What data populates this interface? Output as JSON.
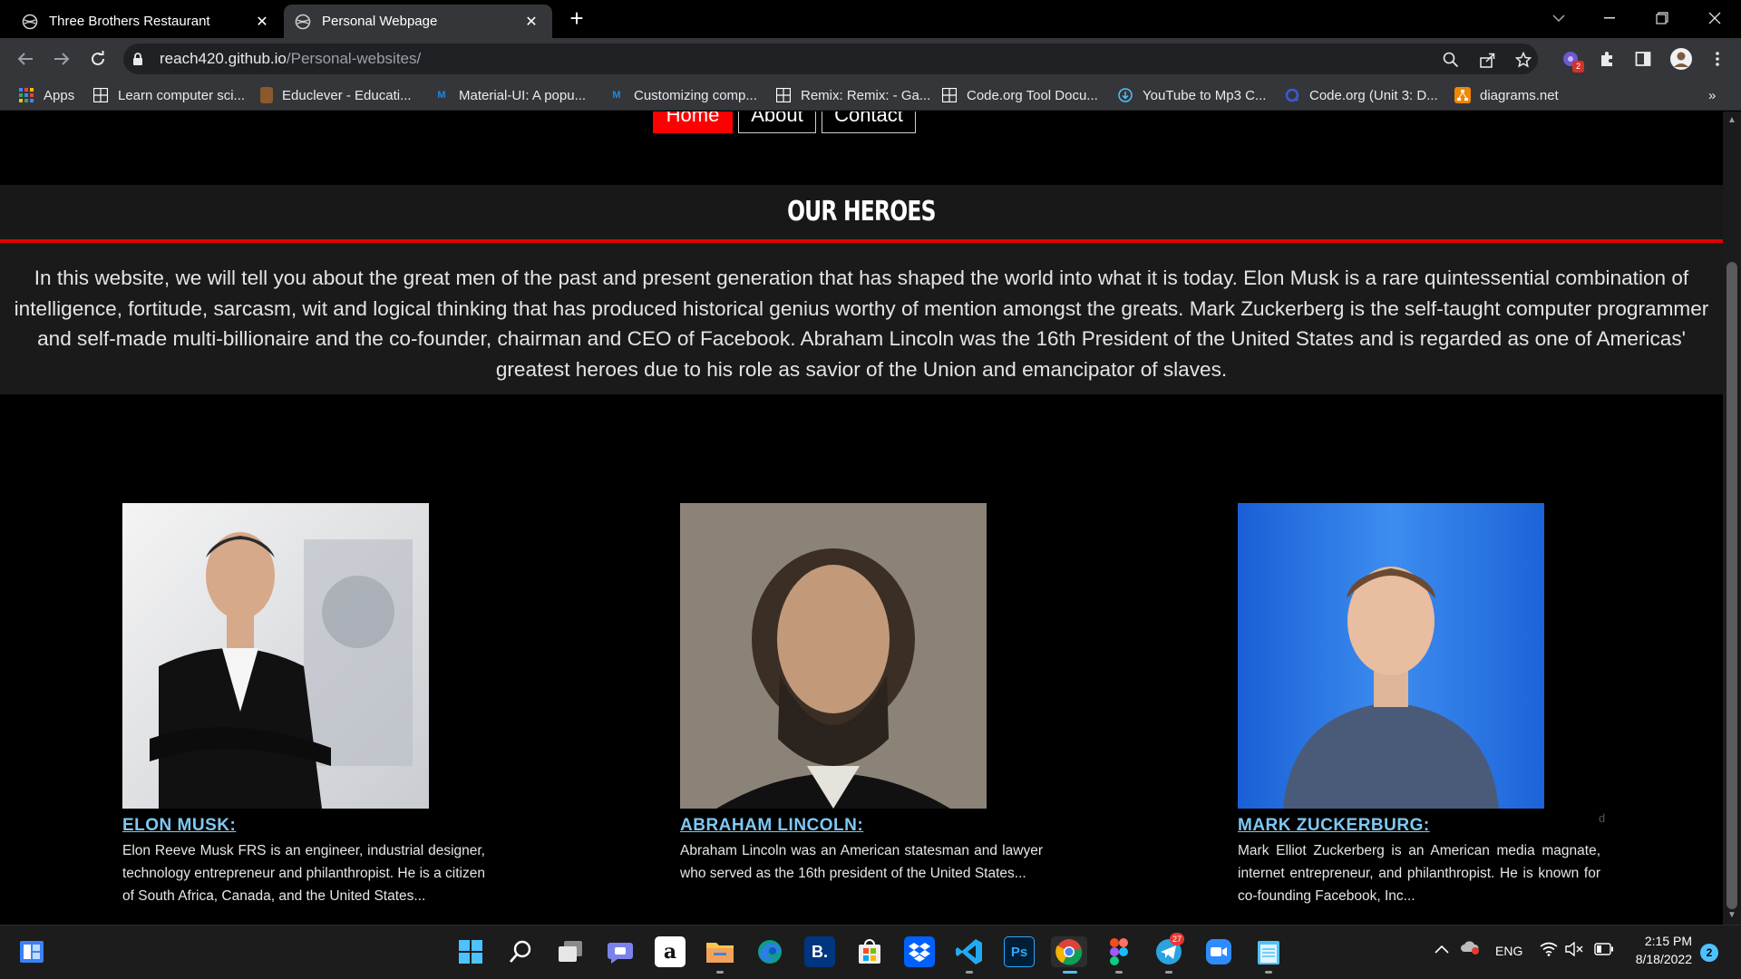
{
  "browser": {
    "tabs": [
      {
        "title": "Three Brothers Restaurant",
        "active": false
      },
      {
        "title": "Personal Webpage",
        "active": true
      }
    ],
    "url_host": "reach420.github.io",
    "url_path": "/Personal-websites/",
    "extension_badge": "2",
    "bookmarks": [
      {
        "label": "Apps",
        "icon": "apps-grid-icon",
        "color": "#4285f4"
      },
      {
        "label": "Learn computer sci...",
        "icon": "code-org-icon",
        "color": "#ffffff"
      },
      {
        "label": "Educlever - Educati...",
        "icon": "educlever-icon",
        "color": "#8a5a2b"
      },
      {
        "label": "Material-UI: A popu...",
        "icon": "mui-icon",
        "color": "#1e88e5"
      },
      {
        "label": "Customizing comp...",
        "icon": "mui-icon",
        "color": "#1e88e5"
      },
      {
        "label": "Remix: Remix: - Ga...",
        "icon": "code-org-icon",
        "color": "#ffffff"
      },
      {
        "label": "Code.org Tool Docu...",
        "icon": "code-org-icon",
        "color": "#ffffff"
      },
      {
        "label": "YouTube to Mp3 C...",
        "icon": "download-icon",
        "color": "#4fc3f7"
      },
      {
        "label": "Code.org (Unit 3: D...",
        "icon": "circle-q-icon",
        "color": "#3b5bdb"
      },
      {
        "label": "diagrams.net",
        "icon": "diagrams-icon",
        "color": "#f08705"
      }
    ]
  },
  "page": {
    "nav": {
      "home": "Home",
      "about": "About",
      "contact": "Contact"
    },
    "heroes_title": "OUR HEROES",
    "intro": "In this website, we will tell you about the great men of the past and present generation that has shaped the world into what it is today. Elon Musk is a rare quintessential combination of intelligence, fortitude, sarcasm, wit and logical thinking that has produced historical genius worthy of mention amongst the greats. Mark Zuckerberg is the self-taught computer programmer and self-made multi-billionaire and the co-founder, chairman and CEO of Facebook. Abraham Lincoln was the 16th President of the United States and is regarded as one of Americas' greatest heroes due to his role as savior of the Union and emancipator of slaves.",
    "heroes": [
      {
        "name": "ELON MUSK:",
        "description": "Elon Reeve Musk FRS is an engineer, industrial designer, technology entrepreneur and philanthropist. He is a citizen of South Africa, Canada, and the United States..."
      },
      {
        "name": "ABRAHAM LINCOLN:",
        "description": "Abraham Lincoln was an American statesman and lawyer who served as the 16th president of the United States..."
      },
      {
        "name": "MARK ZUCKERBURG:",
        "description": "Mark Elliot Zuckerberg is an American media magnate, internet entrepreneur, and philanthropist. He is known for co-founding Facebook, Inc..."
      }
    ],
    "stray_char": "d"
  },
  "taskbar": {
    "apps": [
      "windows-start-icon",
      "search-icon",
      "task-view-icon",
      "teams-chat-icon",
      "amazon-icon",
      "file-explorer-icon",
      "edge-icon",
      "booking-icon",
      "microsoft-store-icon",
      "dropbox-icon",
      "vscode-icon",
      "photoshop-icon",
      "chrome-icon",
      "figma-icon",
      "telegram-icon",
      "zoom-icon",
      "notepad-icon"
    ],
    "telegram_badge": "27",
    "language": "ENG",
    "time": "2:15 PM",
    "date": "8/18/2022",
    "notification_count": "2"
  }
}
